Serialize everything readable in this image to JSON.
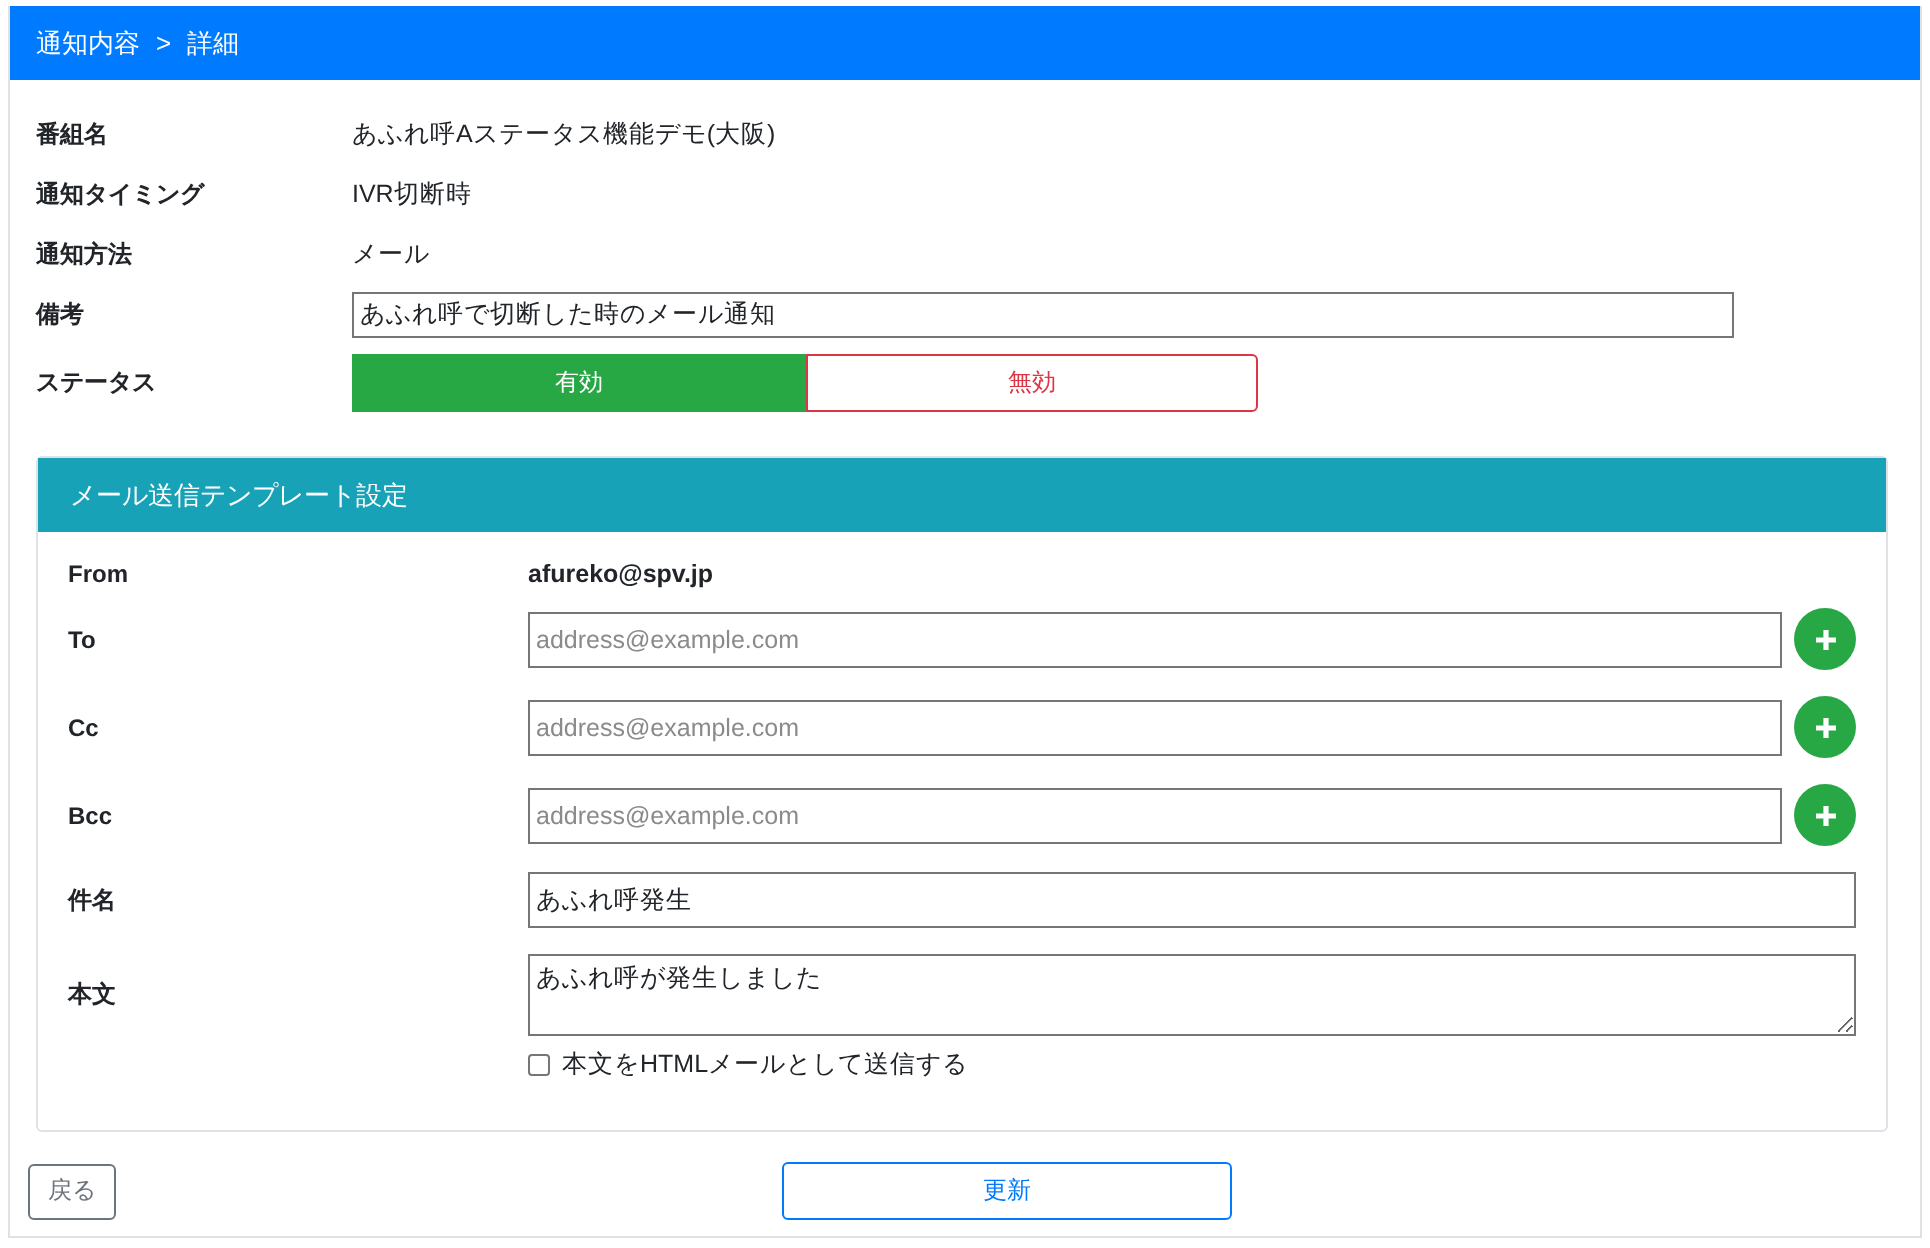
{
  "header": {
    "breadcrumb": [
      "通知内容",
      "詳細"
    ],
    "separator": ">"
  },
  "info": [
    {
      "label": "番組名",
      "kind": "text",
      "value": "あふれ呼Aステータス機能デモ(大阪)"
    },
    {
      "label": "通知タイミング",
      "kind": "text",
      "value": "IVR切断時"
    },
    {
      "label": "通知方法",
      "kind": "text",
      "value": "メール"
    },
    {
      "label": "備考",
      "kind": "input",
      "value": "あふれ呼で切断した時のメール通知"
    }
  ],
  "status": {
    "label": "ステータス",
    "options": [
      {
        "label": "有効",
        "selected": true
      },
      {
        "label": "無効",
        "selected": false
      }
    ]
  },
  "mail_template": {
    "title": "メール送信テンプレート設定",
    "rows": [
      {
        "label": "From",
        "kind": "static",
        "value": "afureko@spv.jp"
      },
      {
        "label": "To",
        "kind": "address",
        "placeholder": "address@example.com"
      },
      {
        "label": "Cc",
        "kind": "address",
        "placeholder": "address@example.com"
      },
      {
        "label": "Bcc",
        "kind": "address",
        "placeholder": "address@example.com"
      },
      {
        "label": "件名",
        "kind": "input",
        "value": "あふれ呼発生"
      },
      {
        "label": "本文",
        "kind": "textarea",
        "value": "あふれ呼が発生しました"
      }
    ],
    "html_option": {
      "label": "本文をHTMLメールとして送信する",
      "checked": false
    }
  },
  "buttons": {
    "back": "戻る",
    "update": "更新"
  }
}
